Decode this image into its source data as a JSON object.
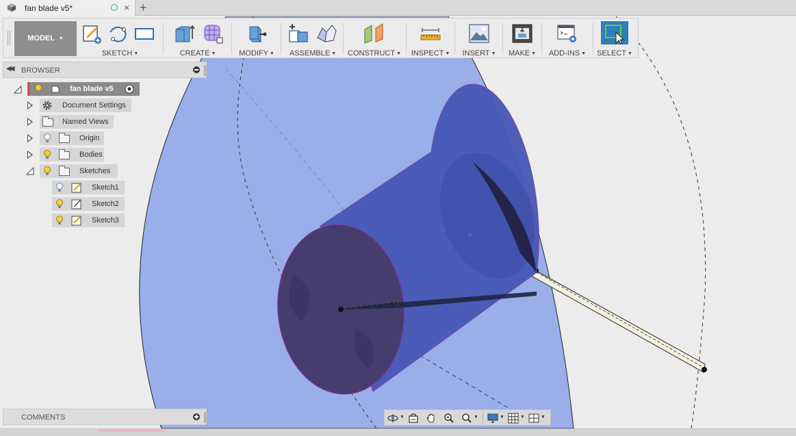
{
  "tab": {
    "title": "fan blade v5*",
    "new_tab_symbol": "+",
    "close_symbol": "×",
    "icons": [
      "box-icon",
      "sync-status-icon",
      "close-icon",
      "plus-icon"
    ]
  },
  "toolbar": {
    "workspace": "MODEL",
    "groups": [
      {
        "label": "SKETCH",
        "icons": [
          "create-sketch-icon",
          "spline-icon",
          "rectangle-icon"
        ]
      },
      {
        "label": "CREATE",
        "icons": [
          "extrude-icon",
          "form-icon"
        ]
      },
      {
        "label": "MODIFY",
        "icons": [
          "press-pull-icon"
        ]
      },
      {
        "label": "ASSEMBLE",
        "icons": [
          "new-component-icon",
          "joint-icon"
        ]
      },
      {
        "label": "CONSTRUCT",
        "icons": [
          "offset-plane-icon"
        ]
      },
      {
        "label": "INSPECT",
        "icons": [
          "measure-icon"
        ]
      },
      {
        "label": "INSERT",
        "icons": [
          "insert-image-icon"
        ]
      },
      {
        "label": "MAKE",
        "icons": [
          "3d-print-icon"
        ]
      },
      {
        "label": "ADD-INS",
        "icons": [
          "scripts-icon"
        ]
      },
      {
        "label": "SELECT",
        "icons": [
          "select-icon"
        ]
      }
    ]
  },
  "browser": {
    "title": "BROWSER",
    "root": "fan blade v5",
    "items": [
      {
        "label": "Document Settings",
        "icon": "gear-icon"
      },
      {
        "label": "Named Views",
        "icon": "folder-icon"
      },
      {
        "label": "Origin",
        "icon": "folder-icon"
      },
      {
        "label": "Bodies",
        "icon": "folder-icon"
      },
      {
        "label": "Sketches",
        "icon": "folder-icon"
      }
    ],
    "sketches": [
      "Sketch1",
      "Sketch2",
      "Sketch3"
    ]
  },
  "comments": {
    "title": "COMMENTS"
  },
  "navbar": {
    "icons": [
      "orbit-icon",
      "look-at-icon",
      "pan-icon",
      "zoom-icon",
      "fit-icon",
      "display-settings-icon",
      "grid-settings-icon",
      "viewports-icon"
    ]
  },
  "colors": {
    "accent": "#2d7fb8",
    "sketch_plane": "#9aaeea",
    "body": "#4a5ab8",
    "toolbar_bg": "#ebebeb"
  }
}
